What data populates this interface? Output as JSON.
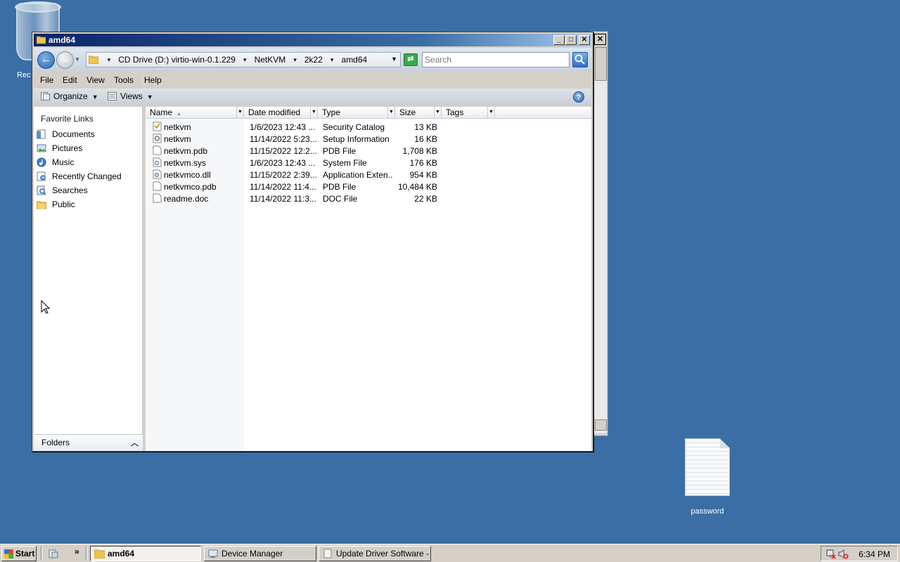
{
  "desktop": {
    "recycle_bin_label": "Rec",
    "password_label": "password"
  },
  "window": {
    "title": "amd64",
    "breadcrumbs": [
      "CD Drive (D:) virtio-win-0.1.229",
      "NetKVM",
      "2k22",
      "amd64"
    ],
    "search_placeholder": "Search",
    "menu": [
      "File",
      "Edit",
      "View",
      "Tools",
      "Help"
    ],
    "toolbar": {
      "organize": "Organize",
      "views": "Views"
    },
    "nav_pane": {
      "title": "Favorite Links",
      "items": [
        "Documents",
        "Pictures",
        "Music",
        "Recently Changed",
        "Searches",
        "Public"
      ],
      "folders_label": "Folders"
    },
    "columns": [
      "Name",
      "Date modified",
      "Type",
      "Size",
      "Tags"
    ],
    "files": [
      {
        "name": "netkvm",
        "date": "1/6/2023 12:43 ...",
        "type": "Security Catalog",
        "size": "13 KB",
        "icon": "catalog-icon"
      },
      {
        "name": "netkvm",
        "date": "11/14/2022 5:23...",
        "type": "Setup Information",
        "size": "16 KB",
        "icon": "setup-info-icon"
      },
      {
        "name": "netkvm.pdb",
        "date": "11/15/2022 12:2...",
        "type": "PDB File",
        "size": "1,708 KB",
        "icon": "file-icon"
      },
      {
        "name": "netkvm.sys",
        "date": "1/6/2023 12:43 ...",
        "type": "System File",
        "size": "176 KB",
        "icon": "system-file-icon"
      },
      {
        "name": "netkvmco.dll",
        "date": "11/15/2022 2:39...",
        "type": "Application Exten...",
        "size": "954 KB",
        "icon": "dll-icon"
      },
      {
        "name": "netkvmco.pdb",
        "date": "11/14/2022 11:4...",
        "type": "PDB File",
        "size": "10,484 KB",
        "icon": "file-icon"
      },
      {
        "name": "readme.doc",
        "date": "11/14/2022 11:3...",
        "type": "DOC File",
        "size": "22 KB",
        "icon": "file-icon"
      }
    ]
  },
  "taskbar": {
    "start_label": "Start",
    "quick_launch_more": "»",
    "tasks": [
      "amd64",
      "Device Manager",
      "Update Driver Software - ..."
    ],
    "clock": "6:34 PM"
  },
  "colors": {
    "desktop": "#3a6ea5",
    "titlebar_start": "#0a246a",
    "titlebar_end": "#a6caf0",
    "chrome": "#d4d0c8"
  }
}
